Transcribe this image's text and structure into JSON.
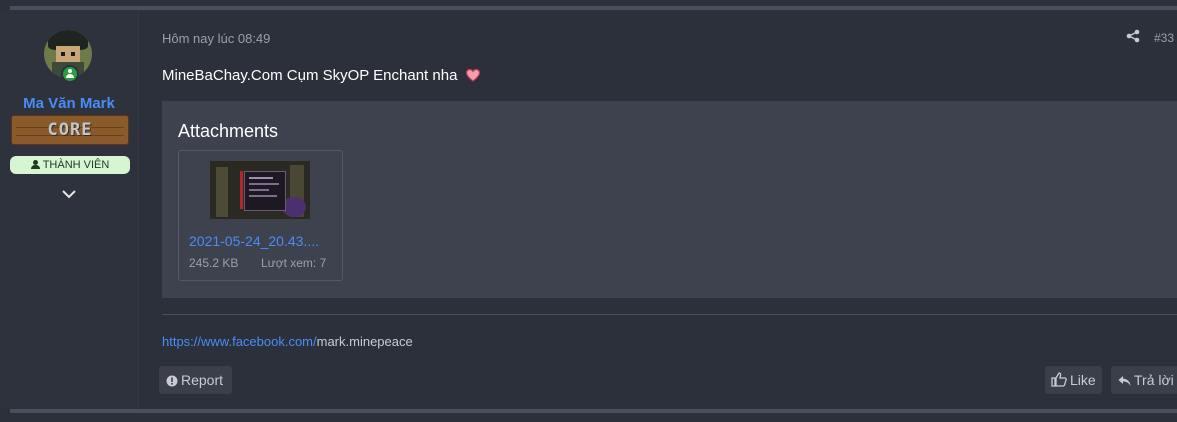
{
  "user": {
    "name": "Ma Văn Mark",
    "banner": "CORE",
    "role": "THÀNH VIÊN"
  },
  "post": {
    "timestamp": "Hôm nay lúc 08:49",
    "number": "#33",
    "message": "MineBaChay.Com Cụm SkyOP Enchant nha"
  },
  "attachments": {
    "title": "Attachments",
    "items": [
      {
        "filename": "2021-05-24_20.43....",
        "size": "245.2 KB",
        "views": "Lượt xem: 7"
      }
    ]
  },
  "signature": {
    "link": "https://www.facebook.com/",
    "rest": "mark.minepeace"
  },
  "actions": {
    "report": "Report",
    "like": "Like",
    "reply": "Trả lời"
  },
  "colors": {
    "background": "#2b303b",
    "link": "#4a8cf7",
    "username": "#4a8cf7",
    "role_badge": "#d7f5d2",
    "online": "#2a9d3e"
  },
  "icons": [
    "online-status-icon",
    "user-icon",
    "chevron-down-icon",
    "share-icon",
    "heart-icon",
    "info-circle-icon",
    "thumbs-up-icon",
    "reply-icon"
  ]
}
